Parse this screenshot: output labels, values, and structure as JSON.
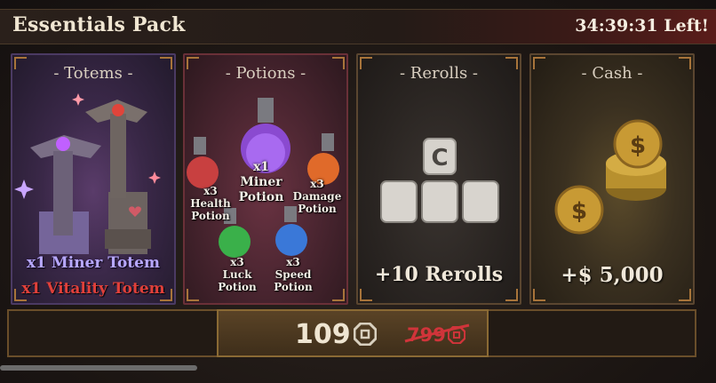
{
  "header": {
    "title": "Essentials Pack",
    "timer": "34:39:31 Left!"
  },
  "cards": {
    "totems": {
      "title": "- Totems -",
      "reward_1": "x1 Miner Totem",
      "reward_2": "x1 Vitality Totem"
    },
    "potions": {
      "title": "- Potions -",
      "miner": "x1 Miner Potion",
      "health": "x3 Health Potion",
      "damage": "x3 Damage Potion",
      "luck": "x3 Luck Potion",
      "speed": "x3 Speed Potion"
    },
    "rerolls": {
      "title": "- Rerolls -",
      "reward": "+10 Rerolls"
    },
    "cash": {
      "title": "- Cash -",
      "reward": "+$ 5,000"
    }
  },
  "purchase": {
    "price": "109",
    "old_price": "799"
  },
  "colors": {
    "vitality_red": "#e0403a",
    "miner_purple": "#b49cff",
    "old_price_red": "#d0343a"
  }
}
